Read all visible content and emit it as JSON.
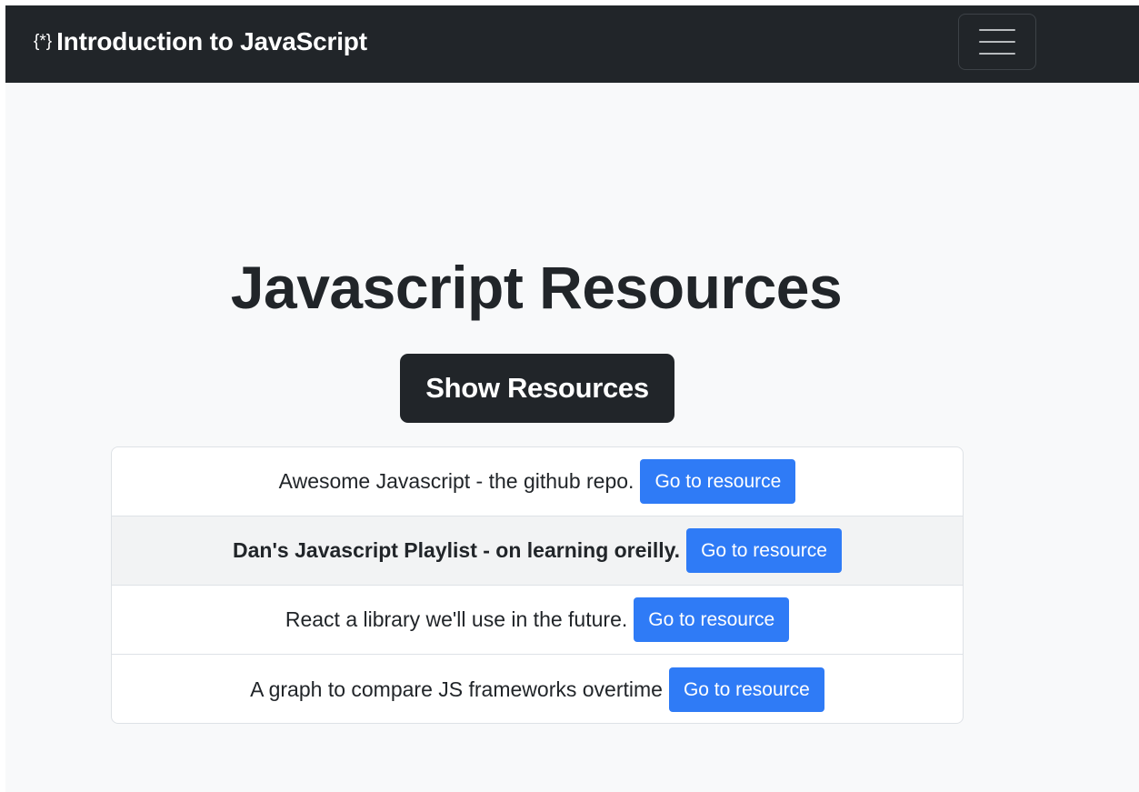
{
  "navbar": {
    "brand_icon": "{*}",
    "brand_text": "Introduction to JavaScript",
    "toggler_icon": "hamburger-menu-icon"
  },
  "main": {
    "title": "Javascript Resources",
    "show_button_label": "Show Resources",
    "resources": [
      {
        "label": "Awesome Javascript - the github repo.",
        "button": "Go to resource"
      },
      {
        "label": "Dan's Javascript Playlist - on learning oreilly.",
        "button": "Go to resource"
      },
      {
        "label": "React a library we'll use in the future.",
        "button": "Go to resource"
      },
      {
        "label": "A graph to compare JS frameworks overtime",
        "button": "Go to resource"
      }
    ]
  },
  "colors": {
    "navbar_bg": "#212529",
    "page_bg": "#f8f9fa",
    "primary": "#2f7bf6",
    "dark_button": "#212529"
  }
}
